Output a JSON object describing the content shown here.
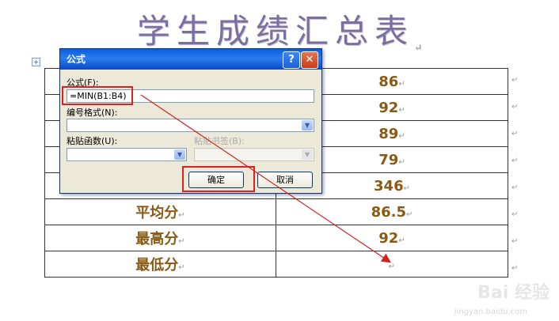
{
  "document": {
    "title": "学生成绩汇总表",
    "para_mark": "↵",
    "move_handle": "+",
    "table": {
      "rows": [
        {
          "label": "",
          "value": "86"
        },
        {
          "label": "",
          "value": "92"
        },
        {
          "label": "",
          "value": "89"
        },
        {
          "label": "",
          "value": "79"
        },
        {
          "label": "",
          "value": "346"
        },
        {
          "label": "平均分",
          "value": "86.5"
        },
        {
          "label": "最高分",
          "value": "92"
        },
        {
          "label": "最低分",
          "value": ""
        }
      ]
    }
  },
  "dialog": {
    "title": "公式",
    "help_glyph": "?",
    "close_glyph": "✕",
    "formula_label": "公式(F):",
    "formula_value": "=MIN(B1:B4)",
    "number_format_label": "编号格式(N):",
    "number_format_value": "",
    "paste_function_label": "粘贴函数(U):",
    "paste_function_value": "",
    "paste_bookmark_label": "粘贴书签(B):",
    "paste_bookmark_value": "",
    "ok_label": "确定",
    "cancel_label": "取消",
    "dropdown_glyph": "▼"
  },
  "watermark": {
    "brand": "Bai 经验",
    "url": "jingyan.baidu.com"
  },
  "colors": {
    "title": "#7b6fa0",
    "cell_text": "#8a5a14",
    "highlight": "#e02020",
    "titlebar": "#0a5ddc"
  }
}
